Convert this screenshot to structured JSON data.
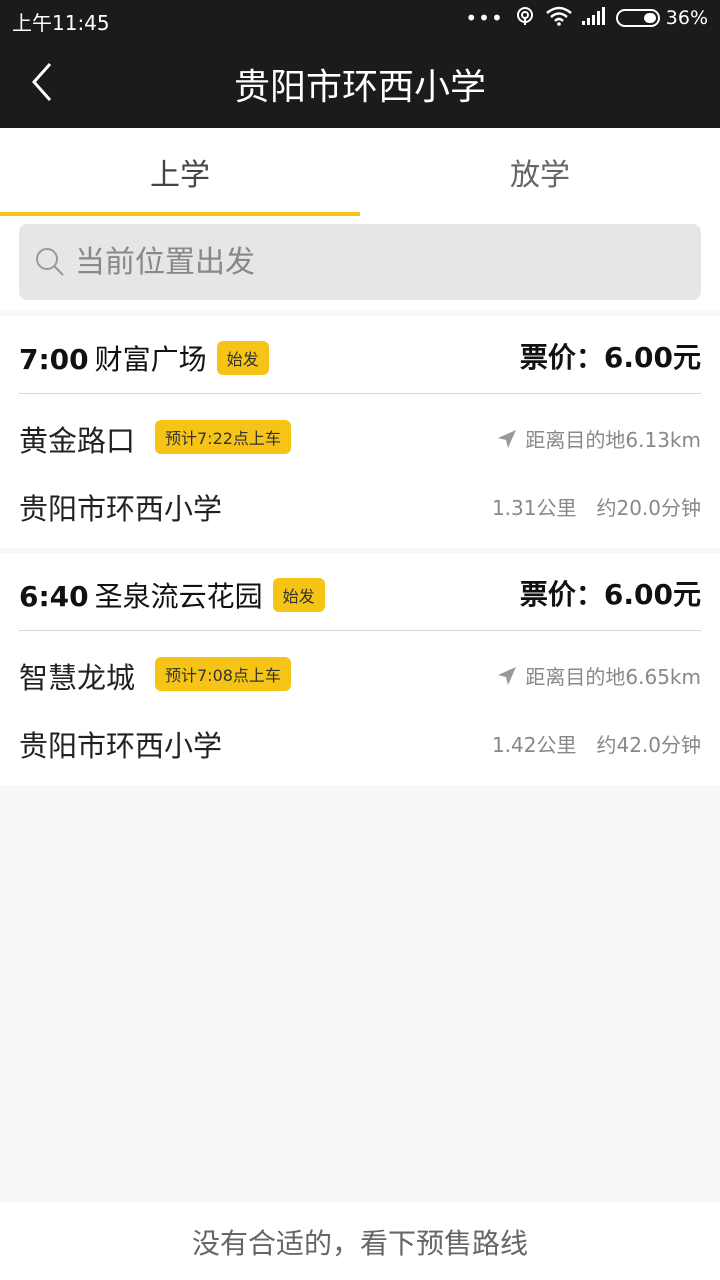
{
  "status_bar": {
    "time": "上午11:45",
    "dots": "•••",
    "battery": "36%"
  },
  "header": {
    "title": "贵阳市环西小学",
    "back_icon": "chevron-left-icon"
  },
  "tabs": [
    {
      "label": "上学",
      "active": true
    },
    {
      "label": "放学",
      "active": false
    }
  ],
  "search": {
    "placeholder": "当前位置出发",
    "icon": "search-icon"
  },
  "routes": [
    {
      "time": "7:00",
      "station": "财富广场",
      "badge": "始发",
      "fare": "票价：6.00元",
      "stop": "黄金路口",
      "eta": "预计7:22点上车",
      "distance": "距离目的地6.13km",
      "destination": "贵阳市环西小学",
      "walk_distance": "1.31公里",
      "duration": "约20.0分钟"
    },
    {
      "time": "6:40",
      "station": "圣泉流云花园",
      "badge": "始发",
      "fare": "票价：6.00元",
      "stop": "智慧龙城",
      "eta": "预计7:08点上车",
      "distance": "距离目的地6.65km",
      "destination": "贵阳市环西小学",
      "walk_distance": "1.42公里",
      "duration": "约42.0分钟"
    }
  ],
  "footer": {
    "link": "没有合适的，看下预售路线"
  },
  "colors": {
    "accent": "#f5c417",
    "header_bg": "#1b1b1b",
    "page_bg": "#f8f8f8"
  }
}
